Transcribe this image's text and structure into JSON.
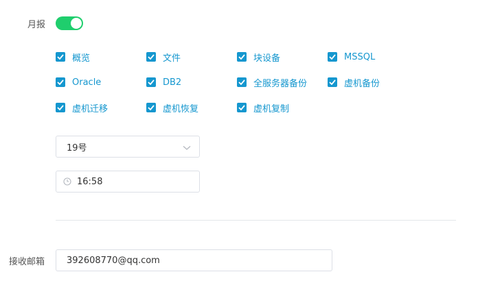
{
  "monthly": {
    "label": "月报",
    "enabled": true
  },
  "options": [
    {
      "label": "概览",
      "checked": true
    },
    {
      "label": "文件",
      "checked": true
    },
    {
      "label": "块设备",
      "checked": true
    },
    {
      "label": "MSSQL",
      "checked": true
    },
    {
      "label": "Oracle",
      "checked": true
    },
    {
      "label": "DB2",
      "checked": true
    },
    {
      "label": "全服务器备份",
      "checked": true
    },
    {
      "label": "虚机备份",
      "checked": true
    },
    {
      "label": "虚机迁移",
      "checked": true
    },
    {
      "label": "虚机恢复",
      "checked": true
    },
    {
      "label": "虚机复制",
      "checked": true
    }
  ],
  "day_select": {
    "value": "19号",
    "icon": "chevron-down-icon"
  },
  "time_picker": {
    "value": "16:58",
    "icon": "clock-icon"
  },
  "email": {
    "label": "接收邮箱",
    "value": "392608770@qq.com"
  },
  "colors": {
    "switch_on": "#1fce6d",
    "checkbox": "#1597cf"
  }
}
